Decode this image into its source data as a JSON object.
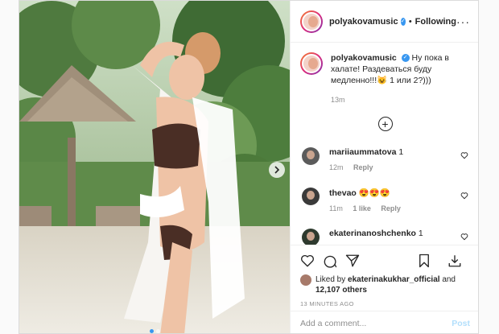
{
  "post": {
    "username": "polyakovamusic",
    "follow_status": "Following",
    "caption_user": "polyakovamusic",
    "caption_text": "Ну пока в халате! Раздеваться буду медленно!!!😺 1 или 2?)))",
    "caption_time": "13m",
    "load_more_icon": "plus-circle-icon",
    "liked_by_prefix": "Liked by",
    "liked_by_user": "ekaterinakukhar_official",
    "liked_by_and": "and",
    "likes_count": "12,107 others",
    "time_ago": "13 MINUTES AGO"
  },
  "comments": [
    {
      "user": "mariiaummatova",
      "text": "1",
      "time": "12m",
      "likes": "",
      "reply": "Reply"
    },
    {
      "user": "thevao",
      "text": "😍😍😍",
      "time": "11m",
      "likes": "1 like",
      "reply": "Reply"
    },
    {
      "user": "ekaterinanoshchenko",
      "text": "1",
      "time": "",
      "likes": "",
      "reply": ""
    }
  ],
  "add_comment": {
    "placeholder": "Add a comment...",
    "post_label": "Post"
  },
  "carousel": {
    "slide_count": 2,
    "active_index": 0
  },
  "colors": {
    "accent": "#3897f0",
    "post_disabled": "#b2dffc",
    "text": "#262626",
    "muted": "#8e8e8e"
  }
}
